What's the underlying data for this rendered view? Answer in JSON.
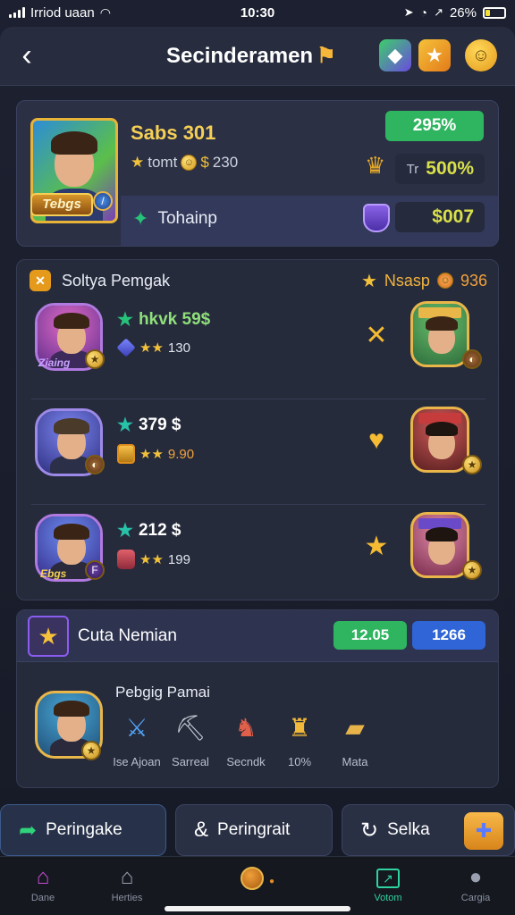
{
  "status_bar": {
    "carrier": "Irriod uaan",
    "time": "10:30",
    "battery": "26%",
    "battery_level": 0.26
  },
  "header": {
    "title": "Secinderamen"
  },
  "profile": {
    "name": "Sabs 301",
    "plate": "Tebgs",
    "stat_label": "tomt",
    "stat_value": "230",
    "badge_percent": "295%",
    "box1_label": "Tr",
    "box1_value": "500%",
    "ability": "Tohainp",
    "box2_value": "$007"
  },
  "list": {
    "title": "Soltya Pemgak",
    "right_label": "Nsasp",
    "right_value": "936",
    "rows": [
      {
        "title": "hkvk 59$",
        "sub": "130",
        "tag": "Ziaing"
      },
      {
        "title": "379 $",
        "sub": "9.90",
        "tag": ""
      },
      {
        "title": "212 $",
        "sub": "199",
        "tag": "Ebgs"
      }
    ]
  },
  "quest": {
    "title": "Cuta Nemian",
    "pill_green": "12.05",
    "pill_blue": "1266",
    "subtitle": "Pebgig Pamai",
    "items": [
      {
        "label": "Ise Ajoan"
      },
      {
        "label": "Sarreal"
      },
      {
        "label": "Secndk"
      },
      {
        "label": "10%"
      },
      {
        "label": "Mata"
      }
    ]
  },
  "actions": [
    {
      "label": "Peringake"
    },
    {
      "label": "Peringrait"
    },
    {
      "label": "Selka"
    }
  ],
  "tabs": [
    {
      "label": "Dane"
    },
    {
      "label": "Herties"
    },
    {
      "label": ""
    },
    {
      "label": "Votom"
    },
    {
      "label": "Cargia"
    }
  ],
  "colors": {
    "accent_green": "#2fb560",
    "accent_blue": "#2f65d6",
    "gold": "#f2c13a"
  }
}
